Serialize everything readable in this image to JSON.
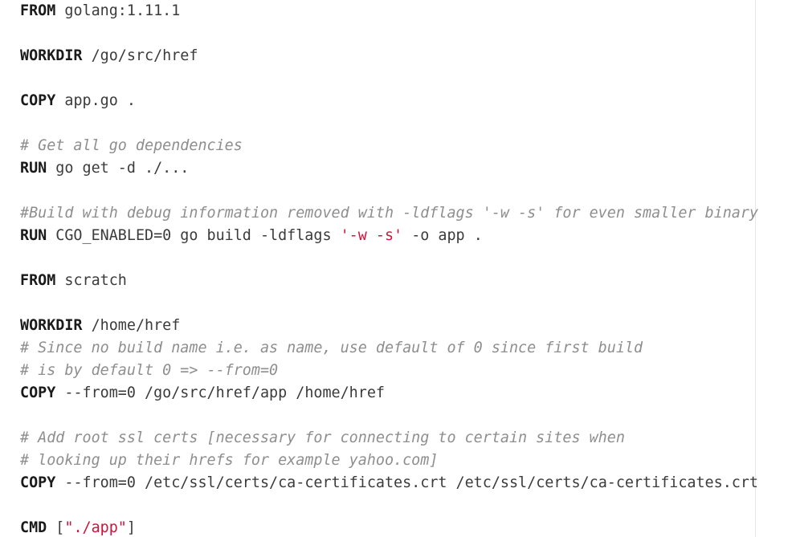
{
  "editor": {
    "colors": {
      "keyword": "#1a1a1a",
      "text": "#3b3b3b",
      "comment": "#8e8e8e",
      "string": "#d0133c",
      "background": "#ffffff"
    },
    "lines": {
      "l1": {
        "kw": "FROM",
        "text": " golang:1.11.1"
      },
      "l3": {
        "kw": "WORKDIR",
        "text": " /go/src/href"
      },
      "l5": {
        "kw": "COPY",
        "text": " app.go ."
      },
      "l7": {
        "comment": "# Get all go dependencies"
      },
      "l8": {
        "kw": "RUN",
        "text": " go get -d ./..."
      },
      "l10": {
        "comment": "#Build with debug information removed with -ldflags '-w -s' for even smaller binary"
      },
      "l11": {
        "kw": "RUN",
        "text": " CGO_ENABLED=0 go build -ldflags ",
        "string": "'-w -s'",
        "text2": " -o app ."
      },
      "l13": {
        "kw": "FROM",
        "text": " scratch"
      },
      "l15": {
        "kw": "WORKDIR",
        "text": " /home/href"
      },
      "l16": {
        "comment": "# Since no build name i.e. as name, use default of 0 since first build"
      },
      "l17": {
        "comment": "# is by default 0 => --from=0"
      },
      "l18": {
        "kw": "COPY",
        "text": " --from=0 /go/src/href/app /home/href"
      },
      "l20": {
        "comment": "# Add root ssl certs [necessary for connecting to certain sites when"
      },
      "l21": {
        "comment": "# looking up their hrefs for example yahoo.com]"
      },
      "l22": {
        "kw": "COPY",
        "text": " --from=0 /etc/ssl/certs/ca-certificates.crt /etc/ssl/certs/ca-certificates.crt"
      },
      "l24": {
        "kw": "CMD",
        "text": " [",
        "string": "\"./app\"",
        "text2": "]"
      }
    }
  }
}
